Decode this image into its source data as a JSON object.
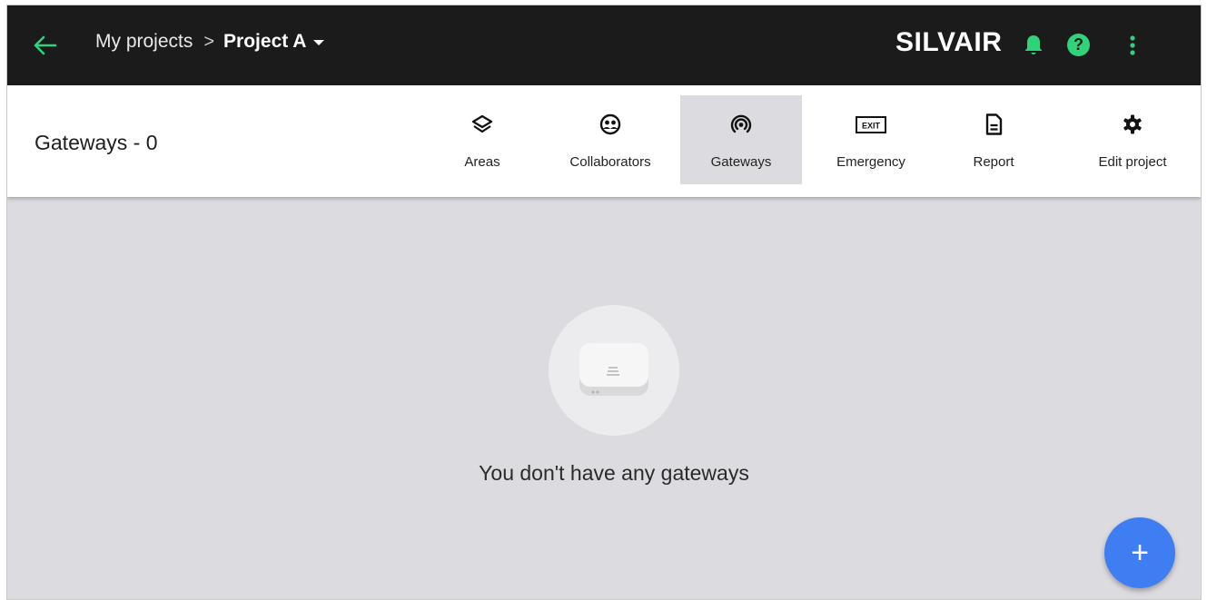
{
  "header": {
    "back_icon": "arrow-left-icon",
    "breadcrumb": {
      "parent": "My projects",
      "separator": ">",
      "current": "Project A"
    },
    "brand": "SILVAIR",
    "help_glyph": "?",
    "accent_color": "#2ed37a"
  },
  "toolbar": {
    "title": "Gateways - 0",
    "tabs": [
      {
        "label": "Areas",
        "icon": "layers-icon",
        "active": false
      },
      {
        "label": "Collaborators",
        "icon": "collaborators-icon",
        "active": false
      },
      {
        "label": "Gateways",
        "icon": "gateway-signal-icon",
        "active": true
      },
      {
        "label": "Emergency",
        "icon": "exit-sign-icon",
        "active": false
      },
      {
        "label": "Report",
        "icon": "document-icon",
        "active": false
      },
      {
        "label": "Edit project",
        "icon": "gear-icon",
        "active": false
      }
    ],
    "exit_sign_text": "EXIT"
  },
  "empty_state": {
    "illustration": "gateway-device-icon",
    "message": "You don't have any gateways"
  },
  "fab": {
    "label": "+",
    "color": "#3f7ef2"
  }
}
